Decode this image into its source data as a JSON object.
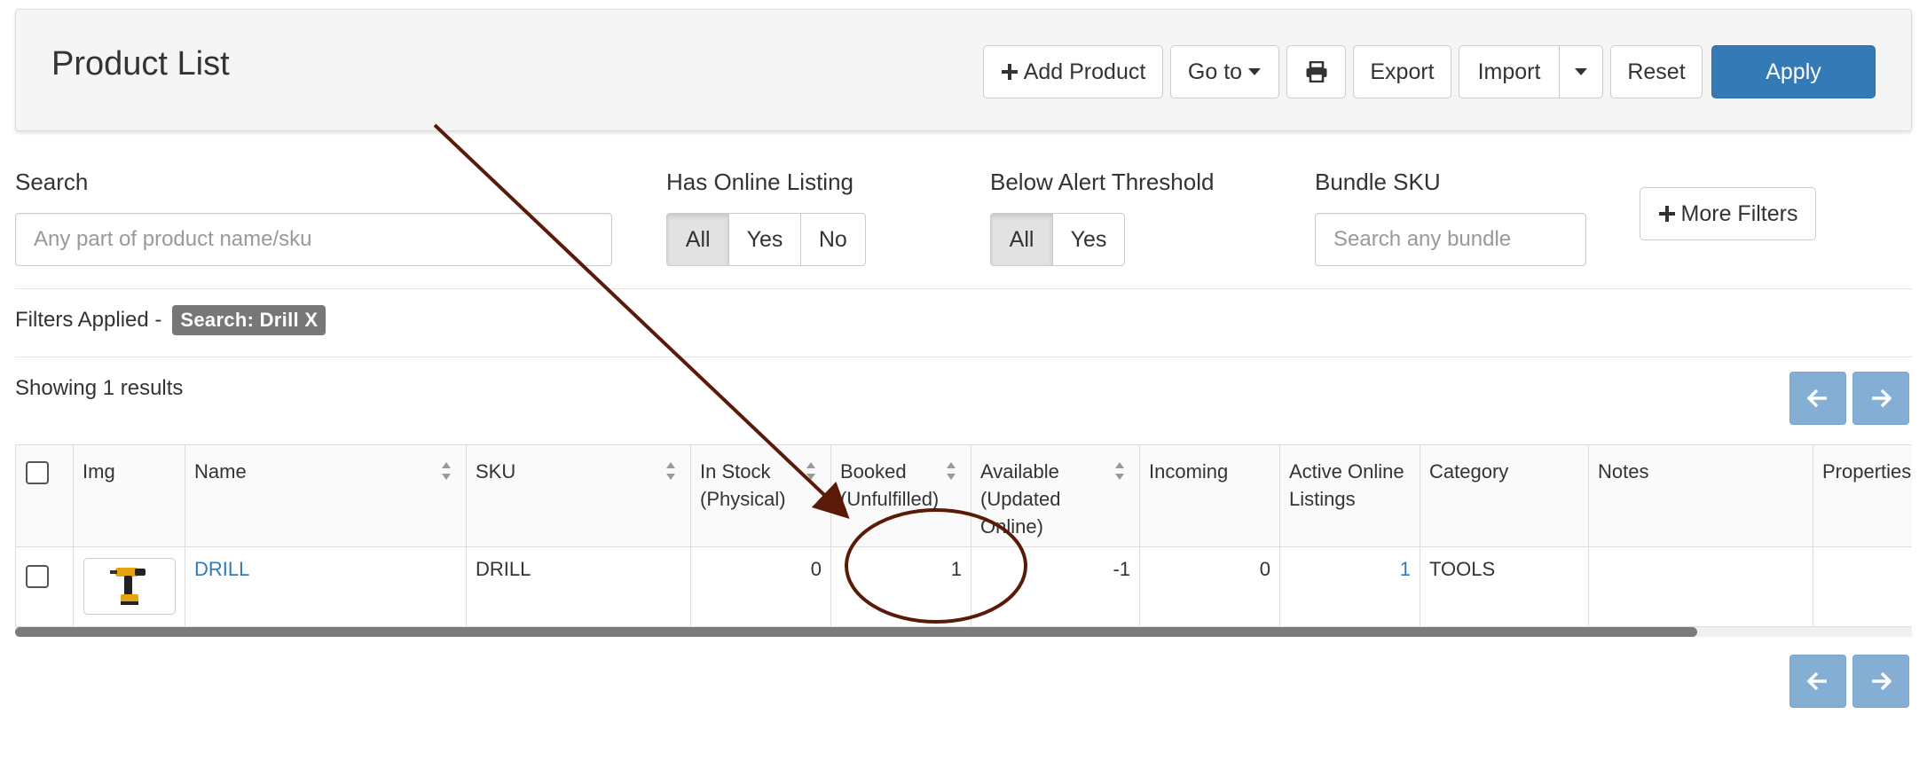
{
  "header": {
    "title": "Product List",
    "add_product": "Add Product",
    "goto": "Go to",
    "export": "Export",
    "import": "Import",
    "reset": "Reset",
    "apply": "Apply"
  },
  "filters": {
    "search": {
      "label": "Search",
      "placeholder": "Any part of product name/sku"
    },
    "online_listing": {
      "label": "Has Online Listing",
      "options": [
        "All",
        "Yes",
        "No"
      ],
      "selected": "All"
    },
    "alert_threshold": {
      "label": "Below Alert Threshold",
      "options": [
        "All",
        "Yes"
      ],
      "selected": "All"
    },
    "bundle_sku": {
      "label": "Bundle SKU",
      "placeholder": "Search any bundle"
    },
    "more_filters": "More Filters"
  },
  "applied": {
    "label": "Filters Applied -",
    "chip": "Search: Drill X"
  },
  "results_text": "Showing 1 results",
  "table": {
    "columns": [
      "Img",
      "Name",
      "SKU",
      "In Stock\n(Physical)",
      "Booked\n(Unfulfilled)",
      "Available\n(Updated\nOnline)",
      "Incoming",
      "Active Online\nListings",
      "Category",
      "Notes",
      "Properties"
    ],
    "rows": [
      {
        "name": "DRILL",
        "sku": "DRILL",
        "in_stock": "0",
        "booked": "1",
        "available": "-1",
        "incoming": "0",
        "active_listings": "1",
        "category": "TOOLS",
        "notes": "",
        "properties": ""
      }
    ]
  },
  "colors": {
    "primary": "#337ab7",
    "nav_button": "#85aed4",
    "annotation": "#5a1a08",
    "chip": "#777777"
  },
  "icons": [
    "plus-icon",
    "caret-down-icon",
    "print-icon",
    "arrow-left-icon",
    "arrow-right-icon",
    "sort-icon",
    "drill-image"
  ]
}
